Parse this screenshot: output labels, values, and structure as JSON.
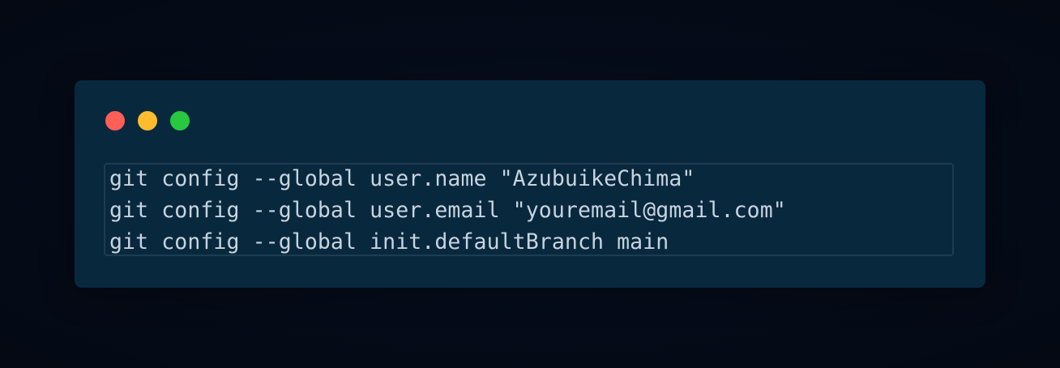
{
  "window": {
    "controls": [
      {
        "name": "close-dot",
        "color": "#ff5f57"
      },
      {
        "name": "minimize-dot",
        "color": "#febc2e"
      },
      {
        "name": "maximize-dot",
        "color": "#28c840"
      }
    ]
  },
  "code": {
    "lines": [
      "git config --global user.name \"AzubuikeChima\"",
      "git config --global user.email \"youremail@gmail.com\"",
      "git config --global init.defaultBranch main"
    ]
  },
  "colors": {
    "page_background": "#050b18",
    "window_background": "#08283e",
    "code_text": "#c8d4de",
    "code_border": "#1d3c52"
  }
}
